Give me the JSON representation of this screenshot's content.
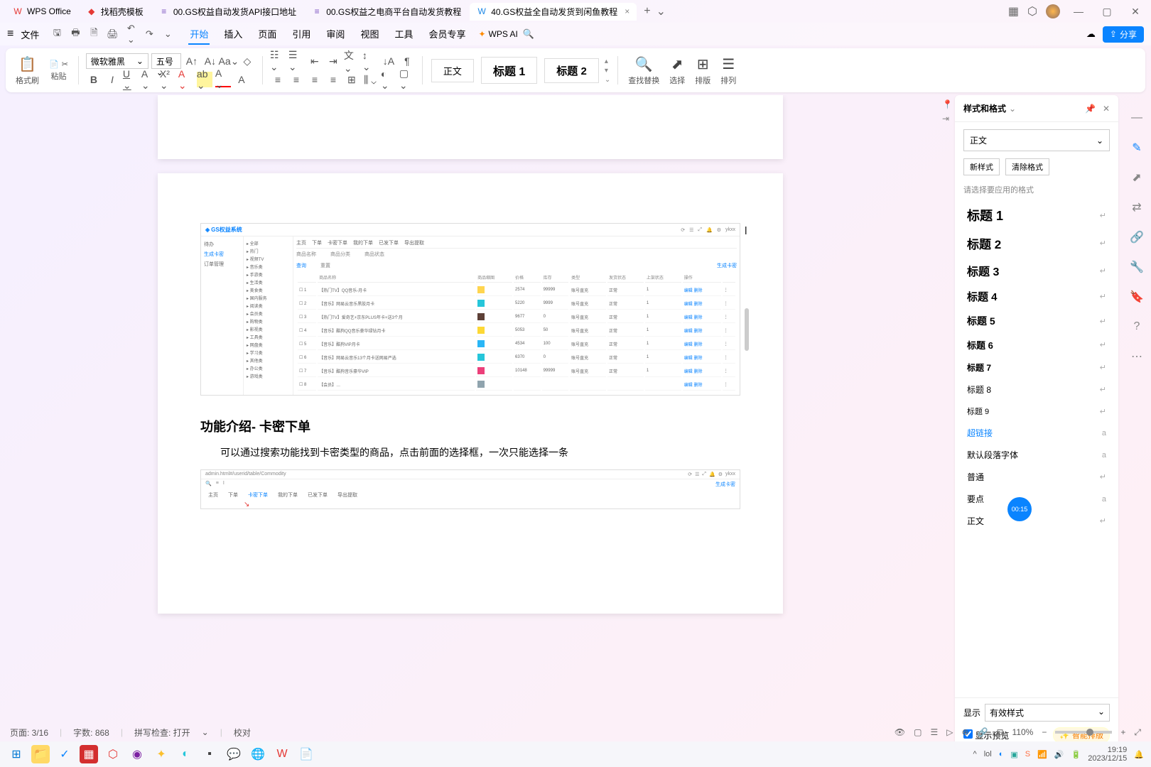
{
  "titlebar": {
    "tabs": [
      {
        "icon": "W",
        "label": "WPS Office"
      },
      {
        "icon": "●",
        "label": "找稻壳模板"
      },
      {
        "icon": "≡",
        "label": "00.GS权益自动发货API接口地址"
      },
      {
        "icon": "≡",
        "label": "00.GS权益之电商平台自动发货教程"
      },
      {
        "icon": "W",
        "label": "40.GS权益全自动发货到闲鱼教程"
      }
    ],
    "add": "+",
    "dropdown": "⌄"
  },
  "menubar": {
    "file": "文件",
    "tabs": [
      "开始",
      "插入",
      "页面",
      "引用",
      "审阅",
      "视图",
      "工具",
      "会员专享"
    ],
    "active": "开始",
    "wpsai": "WPS AI",
    "share": "分享"
  },
  "ribbon": {
    "format_brush": "格式刷",
    "paste": "粘贴",
    "font_name": "微软雅黑",
    "font_size": "五号",
    "style_normal": "正文",
    "style_h1": "标题 1",
    "style_h2": "标题 2",
    "find_replace": "查找替换",
    "select": "选择",
    "layout": "排版",
    "sort": "排列"
  },
  "embed1": {
    "logo": "GS权益系统",
    "user": "ykxx",
    "side": [
      {
        "label": "待办",
        "active": false
      },
      {
        "label": "生成卡密",
        "active": true
      },
      {
        "label": "订单管理",
        "active": false
      }
    ],
    "tree": [
      "全部",
      "热门",
      "视频TV",
      "音乐类",
      "手游类",
      "生活类",
      "美食类",
      "国内服务",
      "阅读类",
      "会员类",
      "购物类",
      "影视类",
      "工具类",
      "网盘类",
      "学习类",
      "其他类",
      "办公类",
      "游戏类"
    ],
    "tabs": [
      "主页",
      "下单",
      "卡密下单",
      "我的下单",
      "已发下单",
      "导出提取"
    ],
    "filters": [
      "商品名称",
      "商品分类",
      "商品状态"
    ],
    "search_btn": "查询",
    "reset_btn": "重置",
    "add_btn": "生成卡密",
    "cols": [
      "",
      "商品名称",
      "商品缩图",
      "价格",
      "库存",
      "类型",
      "发货状态",
      "上架状态",
      "操作",
      ""
    ],
    "rows": [
      {
        "name": "【热门TV】QQ音乐-月卡",
        "img": "#ffd54f",
        "price": "2574",
        "stock": "99999",
        "type": "账号直充",
        "ship": "正常",
        "op": "1"
      },
      {
        "name": "【音乐】网易云音乐黑胶月卡",
        "img": "#26c6da",
        "price": "5220",
        "stock": "9999",
        "type": "账号直充",
        "ship": "正常",
        "op": "1"
      },
      {
        "name": "【热门TV】爱奇艺+京东PLUS年卡+送3个月",
        "img": "#5d4037",
        "price": "9677",
        "stock": "0",
        "type": "账号直充",
        "ship": "正常",
        "op": "1"
      },
      {
        "name": "【音乐】酷狗QQ音乐豪华绿钻月卡",
        "img": "#fdd835",
        "price": "5053",
        "stock": "50",
        "type": "账号直充",
        "ship": "正常",
        "op": "1"
      },
      {
        "name": "【音乐】酷狗VIP月卡",
        "img": "#29b6f6",
        "price": "4534",
        "stock": "100",
        "type": "账号直充",
        "ship": "正常",
        "op": "1"
      },
      {
        "name": "【音乐】网易云音乐13个月卡送网易严选",
        "img": "#26c6da",
        "price": "6370",
        "stock": "0",
        "type": "账号直充",
        "ship": "正常",
        "op": "1"
      },
      {
        "name": "【音乐】酷狗音乐豪华VIP",
        "img": "#ec407a",
        "price": "10148",
        "stock": "99999",
        "type": "账号直充",
        "ship": "正常",
        "op": "1"
      },
      {
        "name": "【会员】…",
        "img": "#90a4ae",
        "price": "",
        "stock": "",
        "type": "",
        "ship": "",
        "op": ""
      }
    ],
    "actions": [
      "编辑",
      "删除"
    ]
  },
  "doc": {
    "h2": "功能介绍- 卡密下单",
    "p1": "可以通过搜索功能找到卡密类型的商品，点击前面的选择框，一次只能选择一条"
  },
  "embed2": {
    "url": "admin.html#/userid/table/Commodity",
    "tabs": [
      "主页",
      "下单",
      "卡密下单",
      "我的下单",
      "已发下单",
      "导出提取"
    ],
    "right_btn": "生成卡密"
  },
  "styles_panel": {
    "title": "样式和格式",
    "current": "正文",
    "new_style": "新样式",
    "clear": "清除格式",
    "hint": "请选择要应用的格式",
    "items": [
      {
        "name": "标题 1",
        "cls": "h1",
        "mark": "↵"
      },
      {
        "name": "标题 2",
        "cls": "h2",
        "mark": "↵"
      },
      {
        "name": "标题 3",
        "cls": "h3",
        "mark": "↵"
      },
      {
        "name": "标题 4",
        "cls": "h4",
        "mark": "↵"
      },
      {
        "name": "标题 5",
        "cls": "h5",
        "mark": "↵"
      },
      {
        "name": "标题 6",
        "cls": "h6",
        "mark": "↵"
      },
      {
        "name": "标题 7",
        "cls": "h7",
        "mark": "↵"
      },
      {
        "name": "标题 8",
        "cls": "h8",
        "mark": "↵"
      },
      {
        "name": "标题 9",
        "cls": "h9",
        "mark": "↵"
      },
      {
        "name": "超链接",
        "cls": "link",
        "mark": "a"
      },
      {
        "name": "默认段落字体",
        "cls": "normal",
        "mark": "a"
      },
      {
        "name": "普通",
        "cls": "normal",
        "mark": "↵"
      },
      {
        "name": "要点",
        "cls": "normal",
        "mark": "a"
      },
      {
        "name": "正文",
        "cls": "normal",
        "mark": "↵"
      }
    ],
    "show_label": "显示",
    "show_value": "有效样式",
    "preview_cb": "显示预览",
    "smart": "智能排版",
    "timer": "00:15"
  },
  "statusbar": {
    "page": "页面: 3/16",
    "words": "字数: 868",
    "spell": "拼写检查: 打开",
    "proof": "校对"
  },
  "zoom": "110%",
  "taskbar": {
    "time": "19:19",
    "date": "2023/12/15"
  }
}
